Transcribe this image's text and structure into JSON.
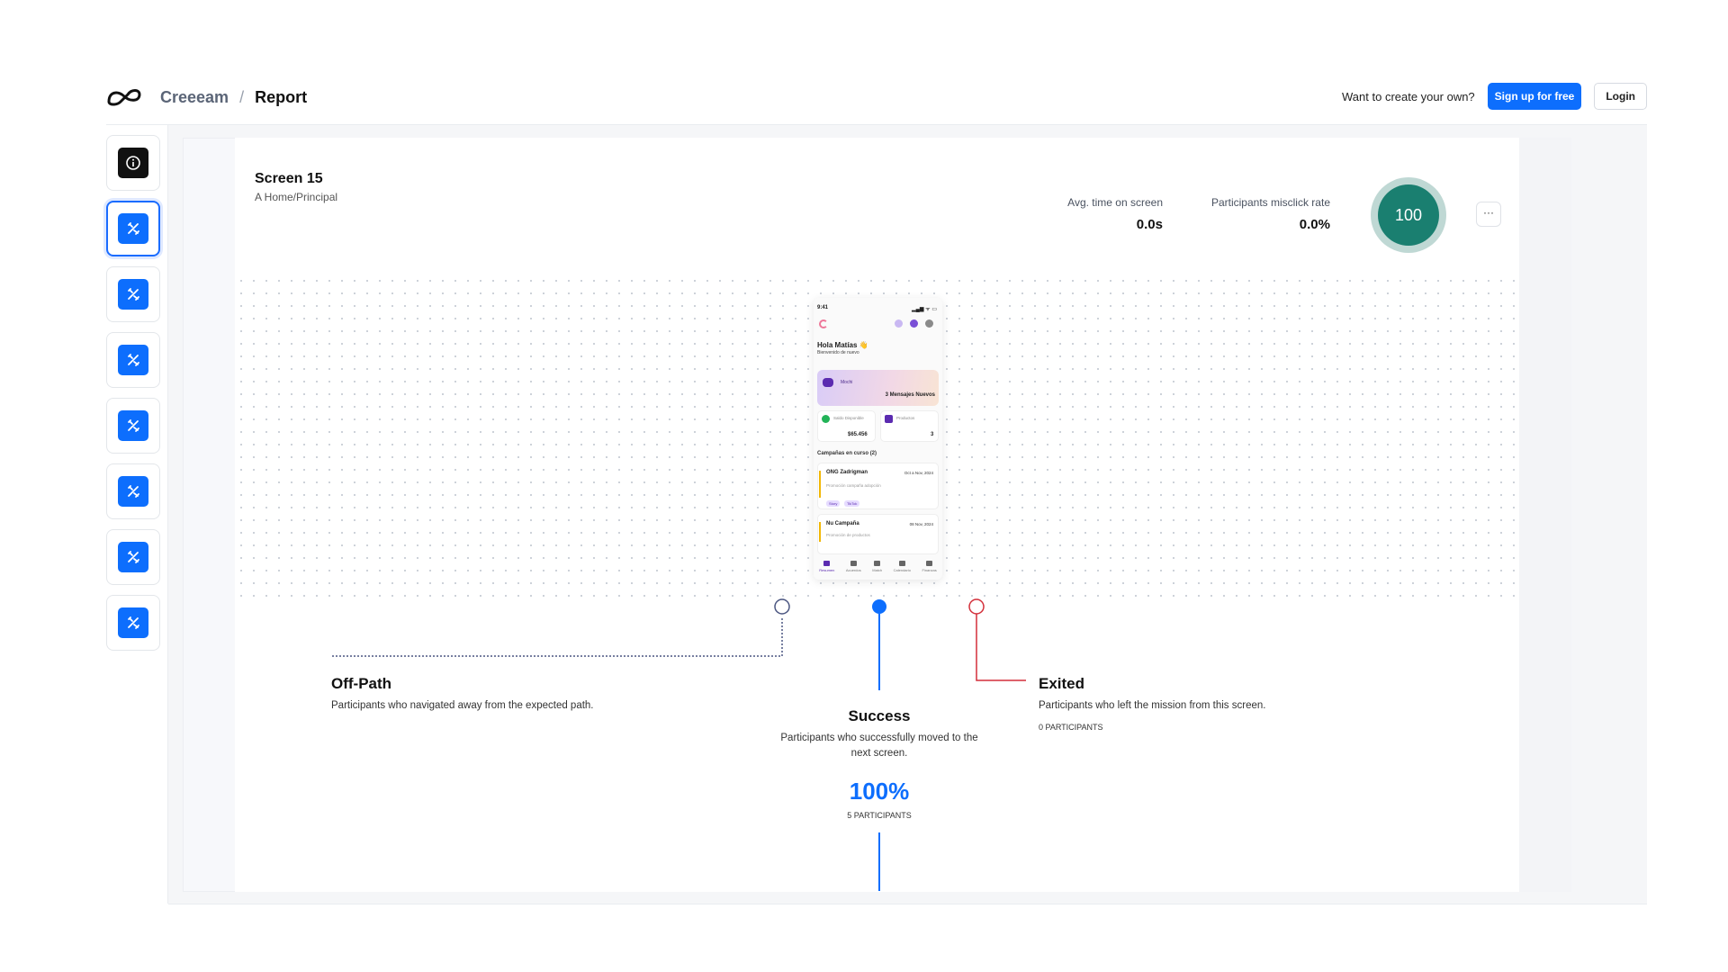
{
  "header": {
    "brand": "Creeeam",
    "separator": "/",
    "page": "Report",
    "prompt": "Want to create your own?",
    "signup_label": "Sign up for free",
    "login_label": "Login"
  },
  "rail": {
    "items": [
      {
        "icon": "info-icon",
        "active": false
      },
      {
        "icon": "figma-tool-icon",
        "active": true
      },
      {
        "icon": "figma-tool-icon",
        "active": false
      },
      {
        "icon": "figma-tool-icon",
        "active": false
      },
      {
        "icon": "figma-tool-icon",
        "active": false
      },
      {
        "icon": "figma-tool-icon",
        "active": false
      },
      {
        "icon": "figma-tool-icon",
        "active": false
      },
      {
        "icon": "figma-tool-icon",
        "active": false
      }
    ]
  },
  "screen": {
    "title": "Screen 15",
    "subtitle": "A Home/Principal",
    "avg_time_label": "Avg. time on screen",
    "avg_time_value": "0.0s",
    "misclick_label": "Participants misclick rate",
    "misclick_value": "0.0%",
    "score": "100",
    "more_label": "···"
  },
  "phone": {
    "time": "9:41",
    "status": "▂▄▆ ᯤ ▭",
    "greeting": "Hola Matías 👋",
    "welcome": "Bienvenido de nuevo",
    "mochi": "Mochi",
    "messages": "3 Mensajes Nuevos",
    "balance_label": "Saldo Disponible",
    "balance_value": "$65.456",
    "products_label": "Productos",
    "products_value": "3",
    "campaigns_title": "Campañas en curso (2)",
    "campaign1_name": "ONG Zadrigman",
    "campaign1_date": "Oct a Nov, 2024",
    "campaign1_desc": "Promoción campaña adopción",
    "tag_story": "Story",
    "tag_tiktok": "TikTok",
    "campaign2_name": "Nu Campaña",
    "campaign2_date": "08 Nov, 2024",
    "campaign2_desc": "Promoción de productos",
    "nav": [
      "Resumen",
      "Acuerdos",
      "Match",
      "Calendario",
      "Finanzas"
    ]
  },
  "flow": {
    "offpath_title": "Off-Path",
    "offpath_desc": "Participants who navigated away from the expected path.",
    "success_title": "Success",
    "success_desc_1": "Participants who successfully moved to the",
    "success_desc_2": "next screen.",
    "success_pct": "100%",
    "success_count": "5 PARTICIPANTS",
    "exited_title": "Exited",
    "exited_desc": "Participants who left the mission from this screen.",
    "exited_count": "0 PARTICIPANTS",
    "colors": {
      "offpath": "#4a5580",
      "success": "#0d6efd",
      "exited": "#d32f3a"
    }
  }
}
